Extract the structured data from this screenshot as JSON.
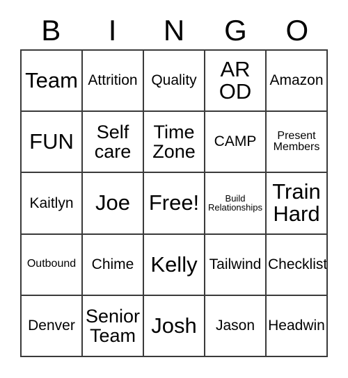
{
  "card": {
    "title": "BINGO",
    "header_letters": [
      "B",
      "I",
      "N",
      "G",
      "O"
    ],
    "border_color": "#3a3a3a",
    "background_color": "#ffffff",
    "text_color": "#000000",
    "rows": 5,
    "columns": 5,
    "cells": [
      [
        {
          "text": "Team",
          "size": "xl"
        },
        {
          "text": "Attrition",
          "size": "md"
        },
        {
          "text": "Quality",
          "size": "md"
        },
        {
          "text": "AR\nOD",
          "size": "xl"
        },
        {
          "text": "Amazon",
          "size": "md"
        }
      ],
      [
        {
          "text": "FUN",
          "size": "xl"
        },
        {
          "text": "Self\ncare",
          "size": "lg"
        },
        {
          "text": "Time\nZone",
          "size": "lg"
        },
        {
          "text": "CAMP",
          "size": "md"
        },
        {
          "text": "Present\nMembers",
          "size": "sm"
        }
      ],
      [
        {
          "text": "Kaitlyn",
          "size": "md"
        },
        {
          "text": "Joe",
          "size": "xl"
        },
        {
          "text": "Free!",
          "size": "xl"
        },
        {
          "text": "Build\nRelationships",
          "size": "xs"
        },
        {
          "text": "Train\nHard",
          "size": "xl"
        }
      ],
      [
        {
          "text": "Outbound",
          "size": "sm"
        },
        {
          "text": "Chime",
          "size": "md"
        },
        {
          "text": "Kelly",
          "size": "xl"
        },
        {
          "text": "Tailwind",
          "size": "md"
        },
        {
          "text": "Checklist",
          "size": "md"
        }
      ],
      [
        {
          "text": "Denver",
          "size": "md"
        },
        {
          "text": "Senior\nTeam",
          "size": "lg"
        },
        {
          "text": "Josh",
          "size": "xl"
        },
        {
          "text": "Jason",
          "size": "md"
        },
        {
          "text": "Headwin",
          "size": "md"
        }
      ]
    ]
  }
}
